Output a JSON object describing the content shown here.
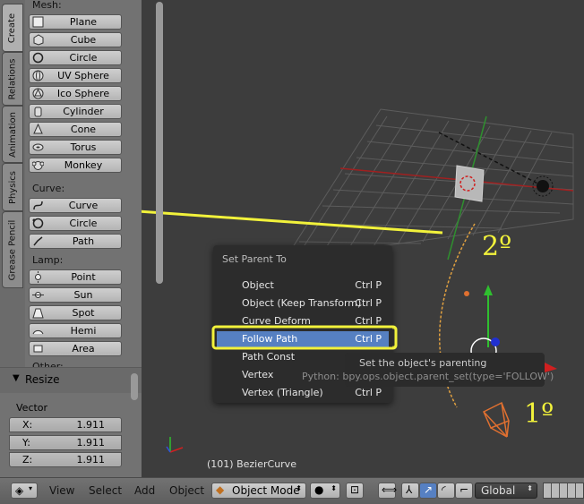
{
  "left_tabs": [
    "Create",
    "Relations",
    "Animation",
    "Physics",
    "Grease Pencil"
  ],
  "mesh": {
    "label": "Mesh:",
    "items": [
      "Plane",
      "Cube",
      "Circle",
      "UV Sphere",
      "Ico Sphere",
      "Cylinder",
      "Cone",
      "Torus",
      "Monkey"
    ]
  },
  "curve": {
    "label": "Curve:",
    "items": [
      "Curve",
      "Circle",
      "Path"
    ]
  },
  "lamp": {
    "label": "Lamp:",
    "items": [
      "Point",
      "Sun",
      "Spot",
      "Hemi",
      "Area"
    ]
  },
  "other_label": "Other:",
  "resize": {
    "title": "Resize",
    "vector_label": "Vector",
    "x_label": "X:",
    "x": "1.911",
    "y_label": "Y:",
    "y": "1.911",
    "z_label": "Z:",
    "z": "1.911"
  },
  "menu": {
    "title": "Set Parent To",
    "items": [
      {
        "label": "Object",
        "shortcut": "Ctrl P"
      },
      {
        "label": "Object (Keep Transform)",
        "shortcut": "Ctrl P"
      },
      {
        "label": "Curve Deform",
        "shortcut": "Ctrl P"
      },
      {
        "label": "Follow Path",
        "shortcut": "Ctrl P"
      },
      {
        "label": "Path Const",
        "shortcut": ""
      },
      {
        "label": "Vertex",
        "shortcut": ""
      },
      {
        "label": "Vertex (Triangle)",
        "shortcut": "Ctrl P"
      }
    ],
    "active_index": 3
  },
  "tooltip": {
    "text": "Set the object's parenting",
    "python": "Python: bpy.ops.object.parent_set(type='FOLLOW')"
  },
  "annotations": {
    "step2": "2º",
    "step1": "1º"
  },
  "status": "(101) BezierCurve",
  "header": {
    "view": "View",
    "select": "Select",
    "add": "Add",
    "object": "Object",
    "mode": "Object Mode",
    "orientation": "Global"
  },
  "colors": {
    "annotation": "#f2f23b",
    "menu_active": "#5680c2",
    "grid": "#5a5a5a",
    "red_axis": "#a02020",
    "green_axis": "#2fbf2f"
  }
}
